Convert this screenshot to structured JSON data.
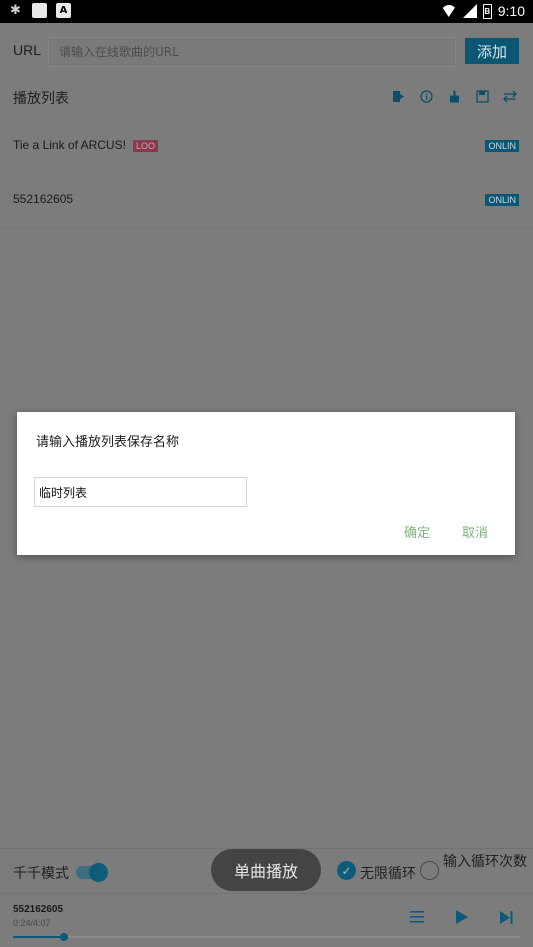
{
  "status_bar": {
    "time": "9:10",
    "battery_label": "B"
  },
  "url_bar": {
    "label": "URL",
    "placeholder": "请输入在线歌曲的URL",
    "add_label": "添加"
  },
  "playlist": {
    "title": "播放列表",
    "items": [
      {
        "title": "Tie a Link of ARCUS!",
        "loop_tag": "LOO",
        "source_tag": "ONLIN"
      },
      {
        "title": "552162605",
        "loop_tag": "",
        "source_tag": "ONLIN"
      }
    ]
  },
  "bottom": {
    "mode_label": "千千模式",
    "single_play_label": "单曲播放",
    "infinite_loop_label": "无限循环",
    "input_loop_label": "输入循环次数",
    "now_playing_title": "552162605",
    "now_playing_time": "0:24/4:07",
    "progress": 0.1
  },
  "dialog": {
    "title": "请输入播放列表保存名称",
    "input_value": "临时列表",
    "confirm_label": "确定",
    "cancel_label": "取消"
  }
}
